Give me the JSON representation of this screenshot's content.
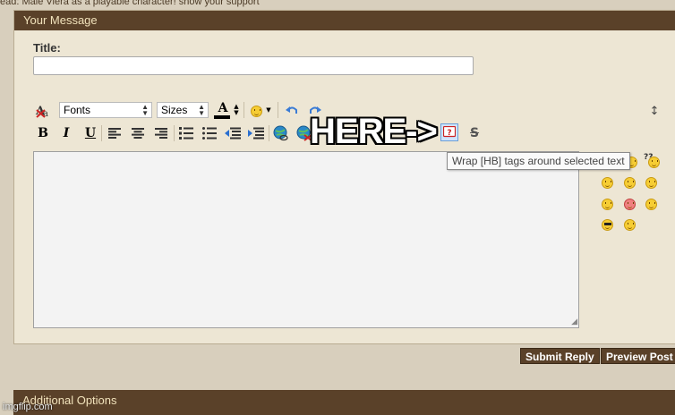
{
  "thread_line": "ead: Male Viera as a playable character! show your support",
  "panel": {
    "header": "Your Message",
    "title_label": "Title:",
    "title_value": ""
  },
  "toolbar": {
    "font_select": "Fonts",
    "size_select": "Sizes",
    "bold": "B",
    "italic": "I",
    "underline": "U",
    "strike": "S",
    "font_color": "A",
    "text_color_hex": "#000000",
    "resize_toggle": "↕",
    "icons": [
      "remove-format-icon",
      "font-color-icon",
      "smiley-icon",
      "undo-icon",
      "redo-icon",
      "align-left-icon",
      "align-center-icon",
      "align-right-icon",
      "ordered-list-icon",
      "unordered-list-icon",
      "outdent-icon",
      "indent-icon",
      "insert-link-icon",
      "remove-link-icon",
      "hb-tag-icon",
      "strikethrough-icon"
    ]
  },
  "annotation": "HERE->",
  "tooltip": "Wrap [HB] tags around selected text",
  "smilies_extra_label": "??",
  "buttons": {
    "submit": "Submit Reply",
    "preview": "Preview Post"
  },
  "additional_options": "Additional Options",
  "watermark": "imgflip.com",
  "colors": {
    "header_bg": "#5a4129",
    "header_text": "#f1e2bb",
    "page_bg": "#d8cfbd",
    "panel_bg": "#ede6d4",
    "accent_red": "#cc2222"
  }
}
